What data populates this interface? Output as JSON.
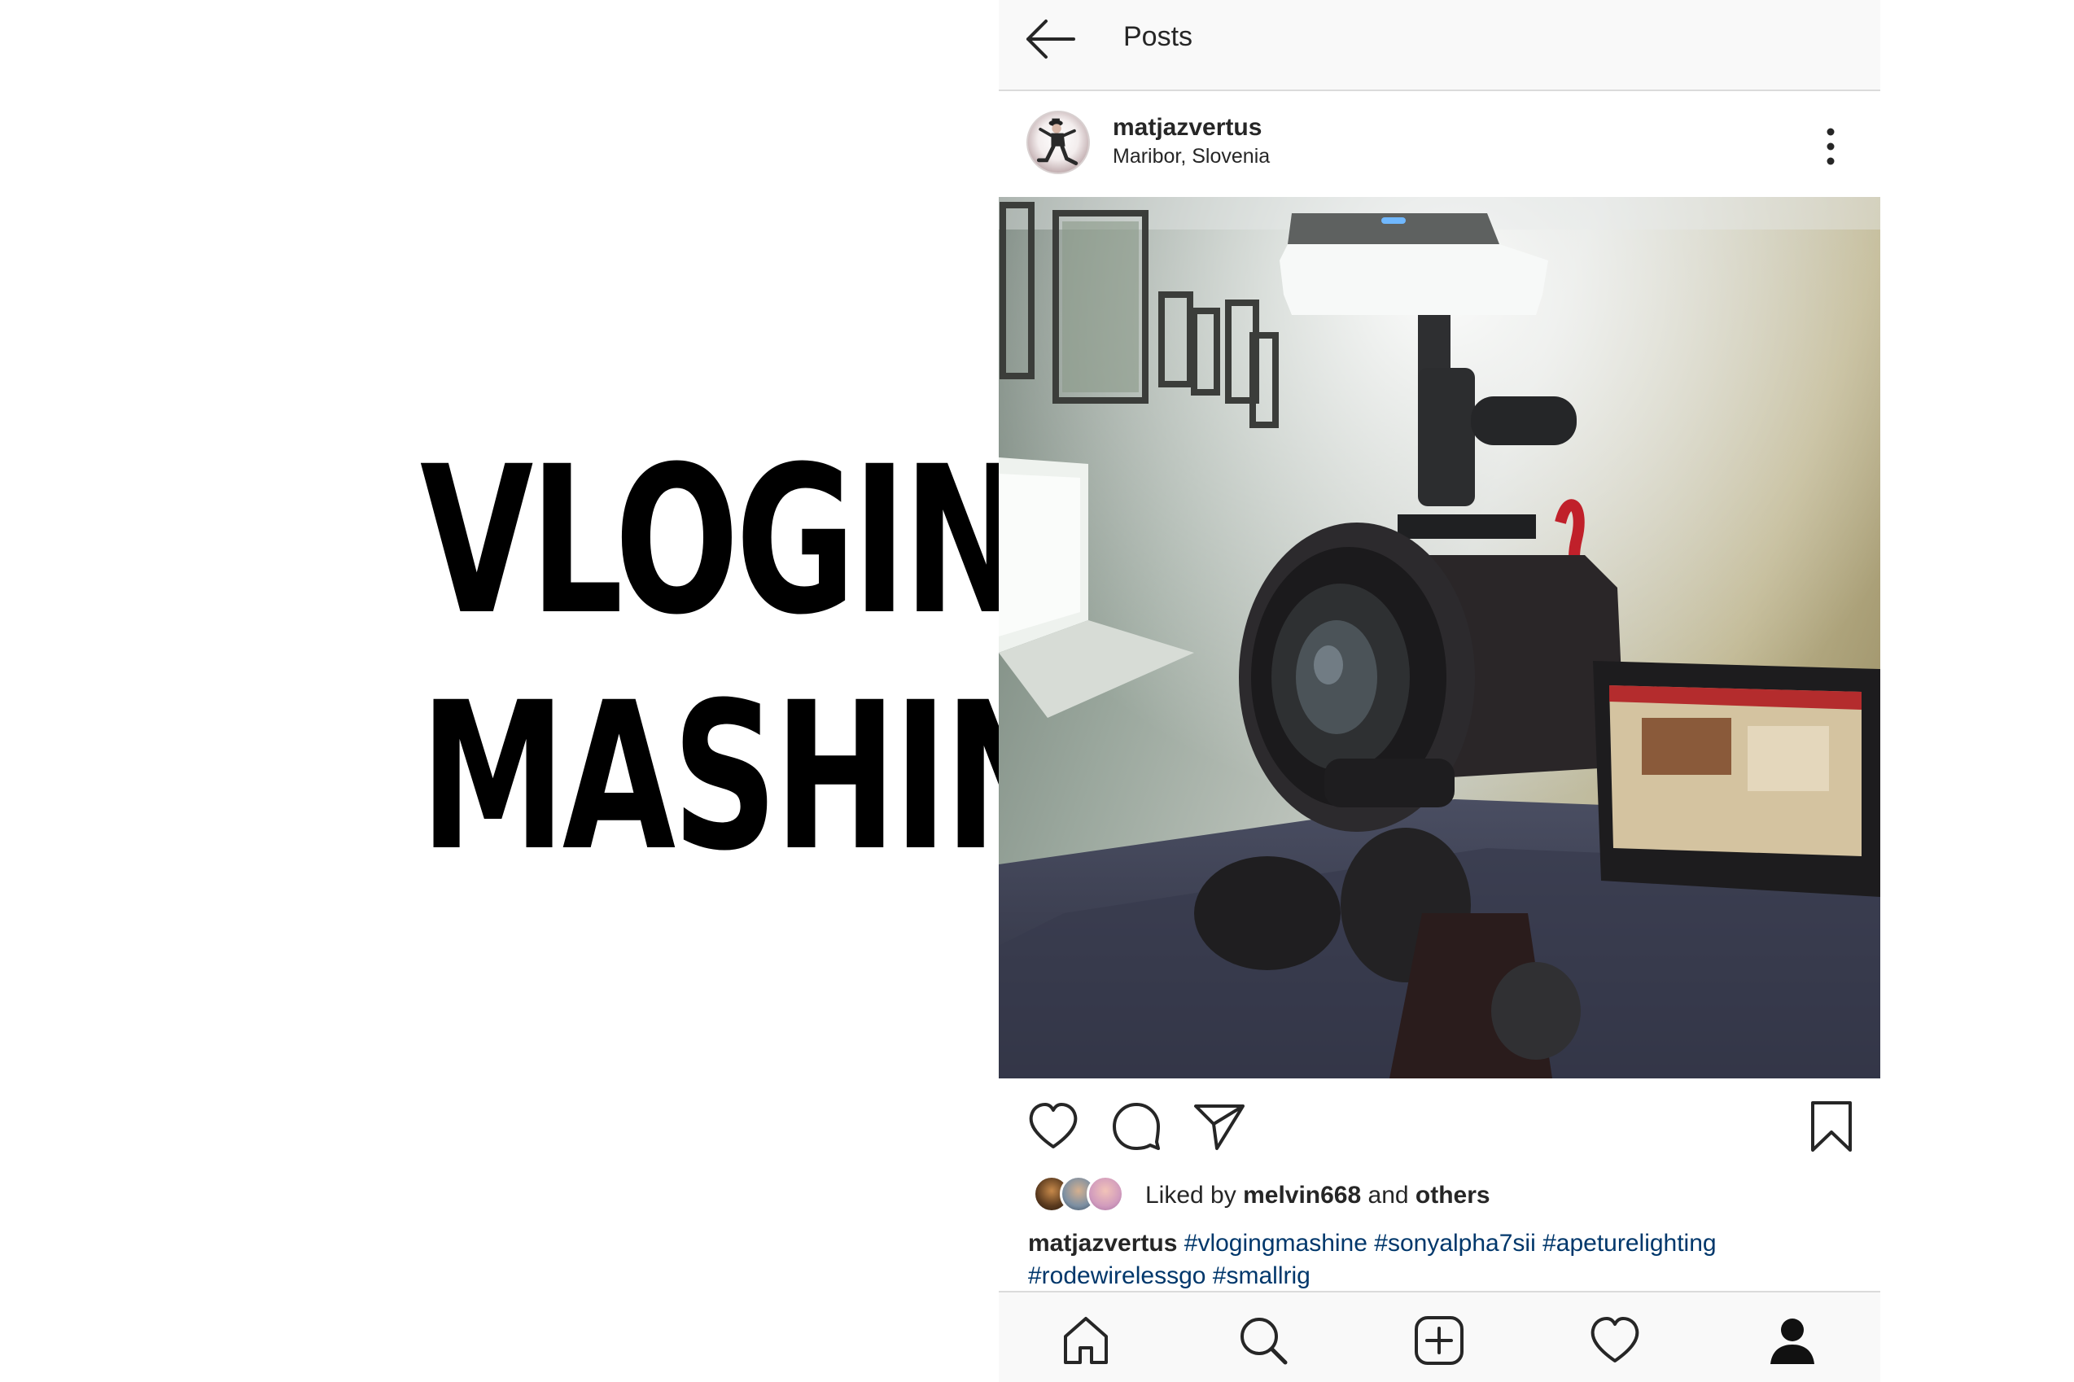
{
  "headline": {
    "line1": "VLOGING",
    "line2": "MASHINE"
  },
  "topbar": {
    "title": "Posts",
    "back_icon": "arrow-left-icon"
  },
  "post": {
    "username": "matjazvertus",
    "location": "Maribor, Slovenia",
    "more_icon": "vertical-dots-icon",
    "photo_alt": "camera rig photo"
  },
  "actions": {
    "like_icon": "heart-icon",
    "comment_icon": "comment-bubble-icon",
    "share_icon": "paper-plane-icon",
    "save_icon": "bookmark-icon"
  },
  "likes": {
    "prefix": "Liked by ",
    "user": "melvin668",
    "and": " and ",
    "others": "others"
  },
  "caption": {
    "user": "matjazvertus",
    "tags": [
      "#vlogingmashine",
      "#sonyalpha7sii",
      "#apeturelighting",
      "#rodewirelessgo",
      "#smallrig"
    ]
  },
  "nav": {
    "home_icon": "home-icon",
    "search_icon": "search-icon",
    "new_post_icon": "plus-square-icon",
    "activity_icon": "heart-icon",
    "profile_icon": "profile-icon"
  },
  "colors": {
    "hashtag": "#00376b",
    "text": "#262626",
    "bar_bg": "#f9f9f9",
    "divider": "#dbdbdb"
  }
}
